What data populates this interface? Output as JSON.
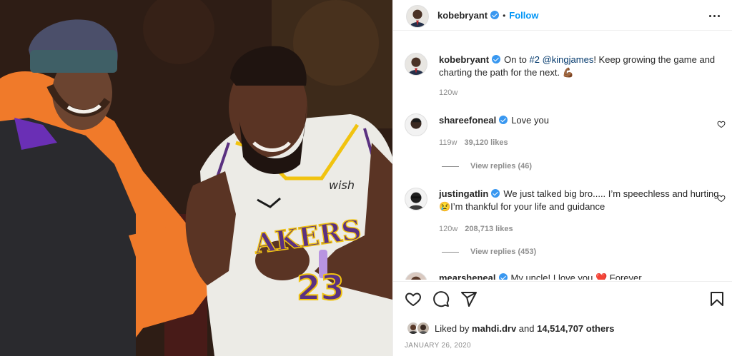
{
  "post": {
    "author": {
      "username": "kobebryant",
      "verified": true,
      "separator": "•",
      "follow_label": "Follow",
      "more_icon": "more-options-icon"
    },
    "caption": {
      "username": "kobebryant",
      "text_before": "On to ",
      "hashtag": "#2",
      "mention": "@kingjames",
      "text_after": "! Keep growing the game and charting the path for the next. ",
      "emoji": "💪🏾",
      "time": "120w"
    },
    "comments": [
      {
        "username": "shareefoneal",
        "verified": true,
        "text": "Love you",
        "time": "119w",
        "likes": "39,120 likes",
        "replies_label": "View replies (46)"
      },
      {
        "username": "justingatlin",
        "verified": true,
        "text": "We just talked big bro..... I’m speechless and hurting 😢I’m thankful for your life and guidance",
        "time": "120w",
        "likes": "208,713 likes",
        "replies_label": "View replies (453)"
      },
      {
        "username": "mearsheneal",
        "verified": true,
        "text": "My uncle! I love you ❤️ Forever"
      }
    ],
    "actions": {
      "like_icon": "heart-icon",
      "comment_icon": "comment-icon",
      "share_icon": "share-icon",
      "save_icon": "bookmark-icon"
    },
    "liked_by": {
      "prefix": "Liked by ",
      "user": "mahdi.drv",
      "middle": " and ",
      "count": "14,514,707 others"
    },
    "date": "JANUARY 26, 2020"
  },
  "colors": {
    "accent": "#0095f6",
    "verified": "#3897f0",
    "muted": "#8e8e8e",
    "text": "#262626"
  }
}
